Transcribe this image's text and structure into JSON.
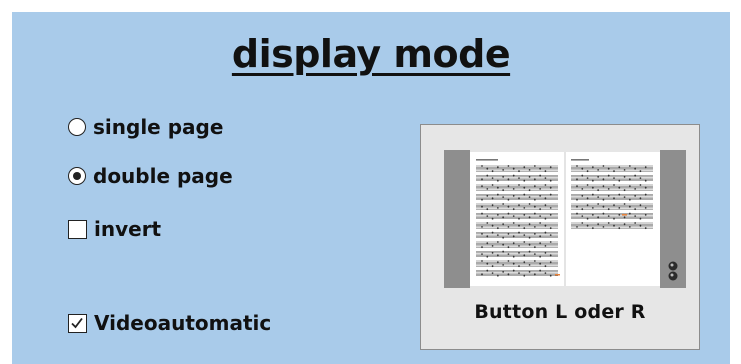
{
  "title": "display mode",
  "options": {
    "single_page": {
      "label": "single page",
      "selected": false
    },
    "double_page": {
      "label": "double page",
      "selected": true
    },
    "invert": {
      "label": "invert",
      "checked": false
    },
    "videoautomatic": {
      "label": "Videoautomatic",
      "checked": true
    }
  },
  "preview": {
    "caption": "Button  L oder R",
    "icon": "sheet-music-double-page"
  },
  "colors": {
    "panel_background": "#a9cbea",
    "preview_background": "#e6e6e6"
  }
}
